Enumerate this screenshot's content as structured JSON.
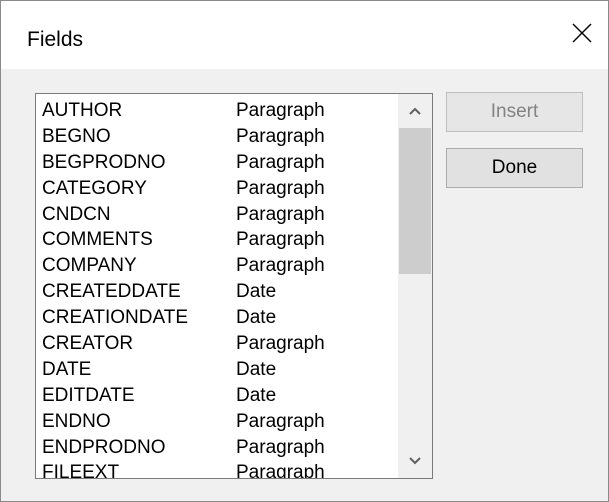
{
  "window": {
    "title": "Fields"
  },
  "buttons": {
    "insert": "Insert",
    "done": "Done"
  },
  "fields": [
    {
      "name": "AUTHOR",
      "type": "Paragraph"
    },
    {
      "name": "BEGNO",
      "type": "Paragraph"
    },
    {
      "name": "BEGPRODNO",
      "type": "Paragraph"
    },
    {
      "name": "CATEGORY",
      "type": "Paragraph"
    },
    {
      "name": "CNDCN",
      "type": "Paragraph"
    },
    {
      "name": "COMMENTS",
      "type": "Paragraph"
    },
    {
      "name": "COMPANY",
      "type": "Paragraph"
    },
    {
      "name": "CREATEDDATE",
      "type": "Date"
    },
    {
      "name": "CREATIONDATE",
      "type": "Date"
    },
    {
      "name": "CREATOR",
      "type": "Paragraph"
    },
    {
      "name": "DATE",
      "type": "Date"
    },
    {
      "name": "EDITDATE",
      "type": "Date"
    },
    {
      "name": "ENDNO",
      "type": "Paragraph"
    },
    {
      "name": "ENDPRODNO",
      "type": "Paragraph"
    },
    {
      "name": "FILEEXT",
      "type": "Paragraph"
    }
  ],
  "icons": {
    "close": "close-icon",
    "scroll_up": "chevron-up-icon",
    "scroll_down": "chevron-down-icon"
  }
}
